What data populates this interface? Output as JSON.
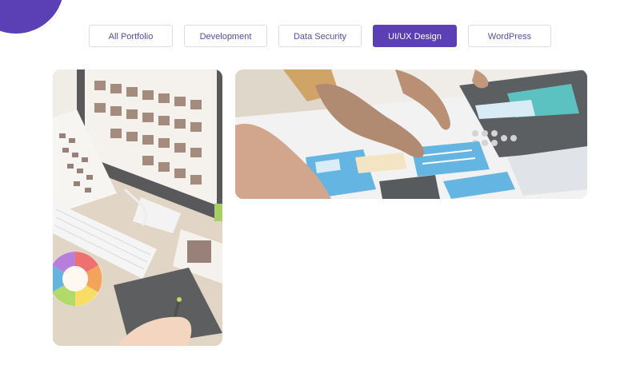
{
  "filters": {
    "items": [
      {
        "label": "All Portfolio"
      },
      {
        "label": "Development"
      },
      {
        "label": "Data Security"
      },
      {
        "label": "UI/UX Design"
      },
      {
        "label": "WordPress"
      }
    ],
    "active_index": 3
  },
  "gallery": {
    "items": [
      {
        "subject": "designer-desk-with-monitor-color-wheel-tablet"
      },
      {
        "subject": "hands-arranging-wireframe-cards"
      }
    ]
  },
  "colors": {
    "accent": "#5b3fb4",
    "button_border": "#dcdce6",
    "button_text": "#5a4aa6"
  }
}
